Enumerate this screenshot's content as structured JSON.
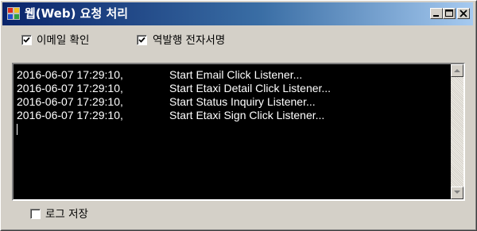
{
  "window": {
    "title": "웹(Web) 요청 처리",
    "icon": "app-grid-icon",
    "controls": [
      "minimize-icon",
      "maximize-icon",
      "close-icon"
    ]
  },
  "options": {
    "email_confirm": {
      "label": "이메일 확인",
      "checked": true
    },
    "reverse_issue": {
      "label": "역발행 전자서명",
      "checked": true
    }
  },
  "log": {
    "lines": [
      {
        "time": "2016-06-07 17:29:10,",
        "message": "Start Email Click Listener..."
      },
      {
        "time": "2016-06-07 17:29:10,",
        "message": "Start Etaxi Detail Click Listener..."
      },
      {
        "time": "2016-06-07 17:29:10,",
        "message": "Start Status Inquiry Listener..."
      },
      {
        "time": "2016-06-07 17:29:10,",
        "message": "Start Etaxi Sign Click Listener..."
      }
    ]
  },
  "footer": {
    "save_log": {
      "label": "로그 저장",
      "checked": false
    }
  },
  "colors": {
    "titlebar_start": "#0a246a",
    "titlebar_end": "#a6caf0",
    "window_face": "#d4d0c8",
    "log_background": "#000000",
    "log_text": "#ffffff"
  }
}
